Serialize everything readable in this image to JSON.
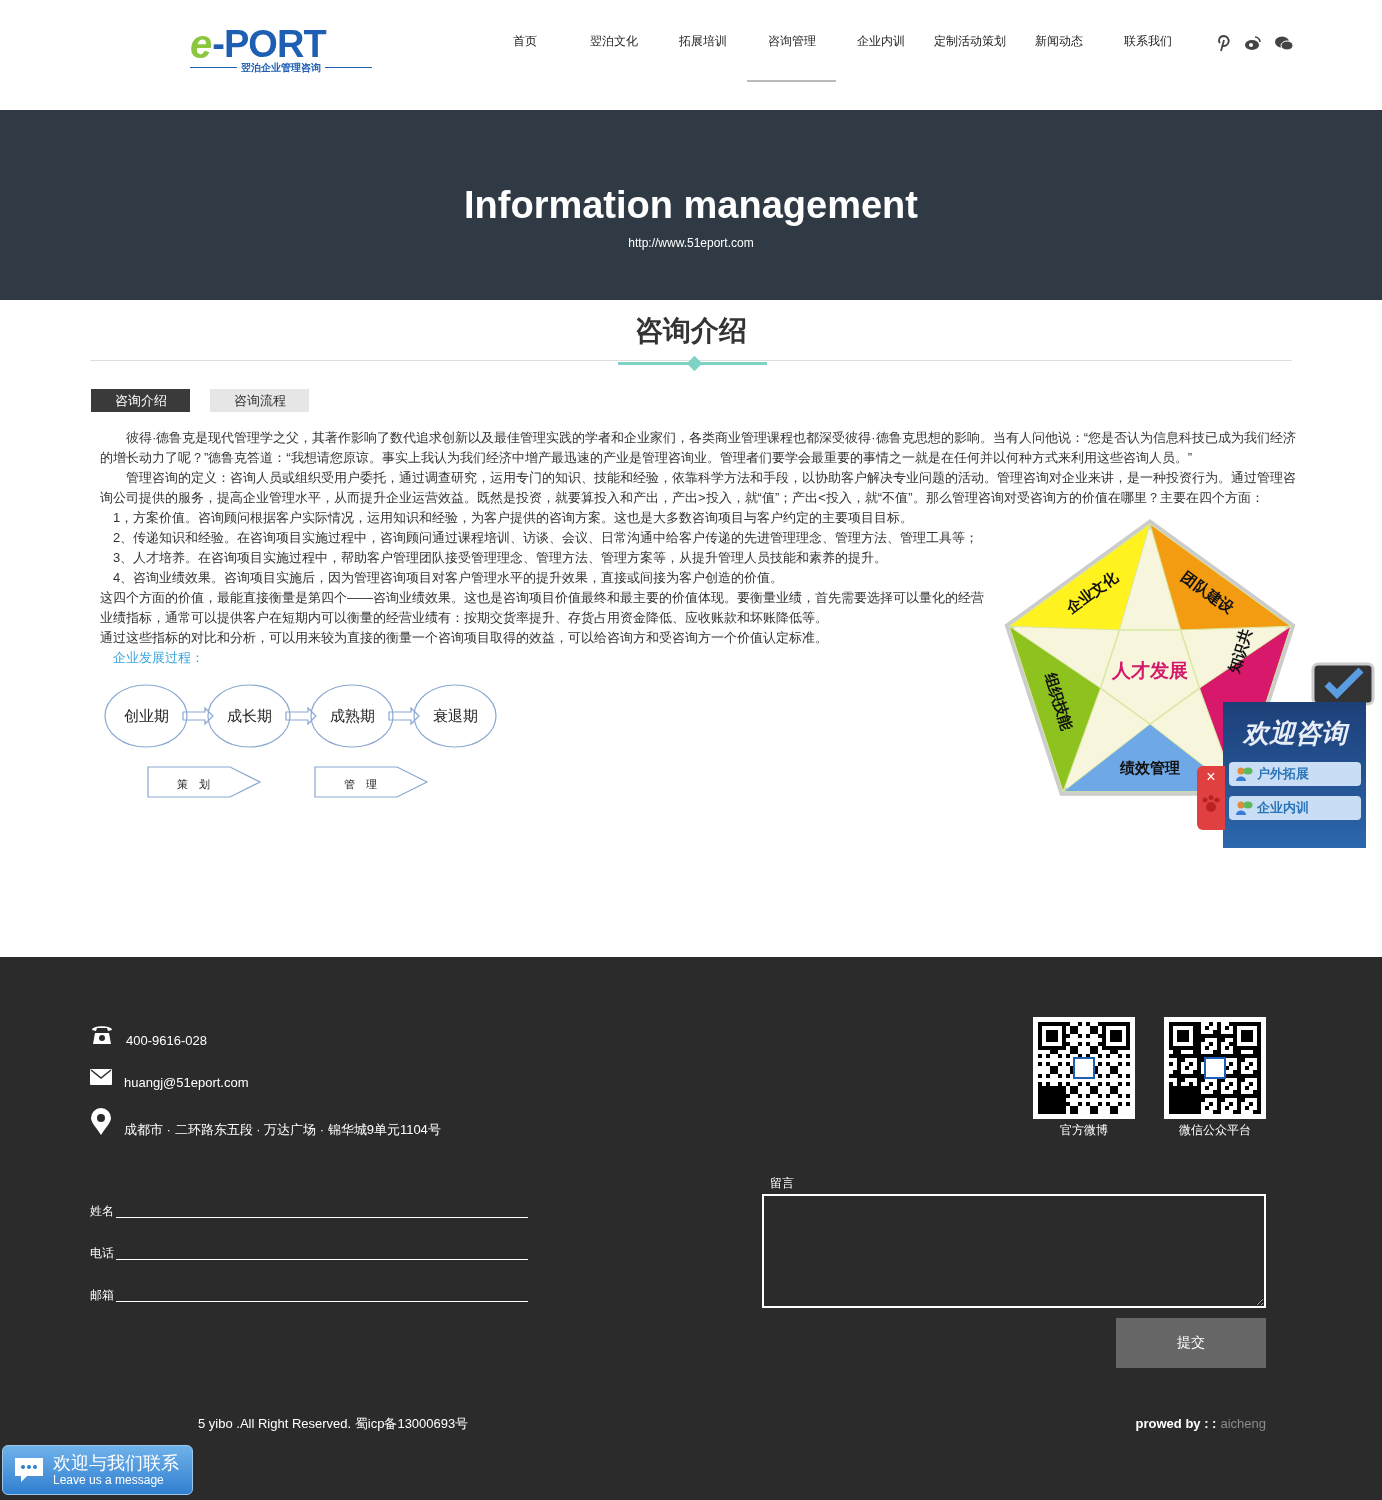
{
  "header": {
    "logo": {
      "mark": "e",
      "word": "-PORT",
      "tagline": "翌泊企业管理咨询"
    },
    "nav": [
      {
        "label": "首页",
        "selected": false
      },
      {
        "label": "翌泊文化",
        "selected": false
      },
      {
        "label": "拓展培训",
        "selected": false
      },
      {
        "label": "咨询管理",
        "selected": true
      },
      {
        "label": "企业内训",
        "selected": false
      },
      {
        "label": "定制活动策划",
        "selected": false
      },
      {
        "label": "新闻动态",
        "selected": false
      },
      {
        "label": "联系我们",
        "selected": false
      }
    ]
  },
  "banner": {
    "title": "Information management",
    "url": "http://www.51eport.com"
  },
  "section": {
    "title": "咨询介绍",
    "tabs": [
      {
        "label": "咨询介绍",
        "selected": true
      },
      {
        "label": "咨询流程",
        "selected": false
      }
    ],
    "paragraphs": [
      {
        "kind": "para",
        "text": "彼得·德鲁克是现代管理学之父，其著作影响了数代追求创新以及最佳管理实践的学者和企业家们，各类商业管理课程也都深受彼得·德鲁克思想的影响。当有人问他说：“您是否认为信息科技已成为我们经济的增长动力了呢？”德鲁克答道：“我想请您原谅。事实上我认为我们经济中增产最迅速的产业是管理咨询业。管理者们要学会最重要的事情之一就是在任何并以何种方式来利用这些咨询人员。”"
      },
      {
        "kind": "para",
        "text": "管理咨询的定义：咨询人员或组织受用户委托，通过调查研究，运用专门的知识、技能和经验，依靠科学方法和手段，以协助客户解决专业问题的活动。管理咨询对企业来讲，是一种投资行为。通过管理咨询公司提供的服务，提高企业管理水平，从而提升企业运营效益。既然是投资，就要算投入和产出，产出>投入，就“值”；产出<投入，就“不值”。那么管理咨询对受咨询方的价值在哪里？主要在四个方面："
      },
      {
        "kind": "item",
        "text": "1，方案价值。咨询顾问根据客户实际情况，运用知识和经验，为客户提供的咨询方案。这也是大多数咨询项目与客户约定的主要项目目标。"
      },
      {
        "kind": "item",
        "text": "2、传递知识和经验。在咨询项目实施过程中，咨询顾问通过课程培训、访谈、会议、日常沟通中给客户传递的先进管理理念、管理方法、管理工具等；"
      },
      {
        "kind": "item",
        "text": "3、人才培养。在咨询项目实施过程中，帮助客户管理团队接受管理理念、管理方法、管理方案等，从提升管理人员技能和素养的提升。"
      },
      {
        "kind": "item",
        "text": "4、咨询业绩效果。咨询项目实施后，因为管理咨询项目对客户管理水平的提升效果，直接或间接为客户创造的价值。"
      },
      {
        "kind": "plain",
        "text": "这四个方面的价值，最能直接衡量是第四个——咨询业绩效果。这也是咨询项目价值最终和最主要的价值体现。要衡量业绩，首先需要选择可以量化的经营业绩指标，通常可以提供客户在短期内可以衡量的经营业绩有：按期交货率提升、存货占用资金降低、应收账款和坏账降低等。"
      },
      {
        "kind": "plain",
        "text": "通过这些指标的对比和分析，可以用来较为直接的衡量一个咨询项目取得的效益，可以给咨询方和受咨询方一个价值认定标准。"
      },
      {
        "kind": "link",
        "text": "企业发展过程："
      }
    ],
    "pentagon": {
      "center": "人才发展",
      "segments": [
        {
          "label": "团队建设",
          "color": "#f39c12"
        },
        {
          "label": "知识共",
          "color": "#d8186a"
        },
        {
          "label": "绩效管理",
          "color": "#6fa8e6"
        },
        {
          "label": "组织技能",
          "color": "#8dc21f"
        },
        {
          "label": "企业文化",
          "color": "#fff21e"
        }
      ]
    },
    "stages": [
      "创业期",
      "成长期",
      "成熟期",
      "衰退期"
    ],
    "phases": [
      "策　划",
      "管　理"
    ]
  },
  "float_widget": {
    "close": "×",
    "title": "欢迎咨询",
    "links": [
      "户外拓展",
      "企业内训"
    ]
  },
  "footer": {
    "phone": "400-9616-028",
    "email": "huangj@51eport.com",
    "address": "成都市 · 二环路东五段 · 万达广场 · 锦华城9单元1104号",
    "qr_codes": [
      "官方微博",
      "微信公众平台"
    ],
    "form": {
      "fields": [
        "姓名",
        "电话",
        "邮箱"
      ],
      "message_label": "留言",
      "submit": "提交"
    },
    "copyright": "5 yibo .All Right Reserved. 蜀icp备13000693号",
    "powered_label": "prowed by : :",
    "powered_name": "aicheng"
  },
  "chat": {
    "title": "欢迎与我们联系",
    "subtitle": "Leave us a message"
  }
}
